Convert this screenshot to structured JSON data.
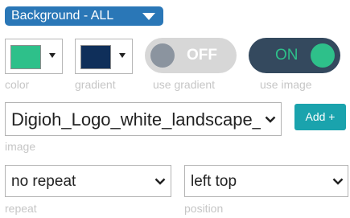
{
  "header": {
    "label": "Background - ALL"
  },
  "colors": {
    "color_swatch": "#2ec08a",
    "gradient_swatch": "#0f2f5a"
  },
  "controls": {
    "color_label": "color",
    "gradient_label": "gradient",
    "use_gradient": {
      "state_label": "OFF",
      "caption": "use gradient"
    },
    "use_image": {
      "state_label": "ON",
      "caption": "use image"
    }
  },
  "image": {
    "selected": "Digioh_Logo_white_landscape_",
    "caption": "image",
    "add_label": "Add +"
  },
  "repeat": {
    "selected": "no repeat",
    "caption": "repeat"
  },
  "position": {
    "selected": "left top",
    "caption": "position"
  }
}
